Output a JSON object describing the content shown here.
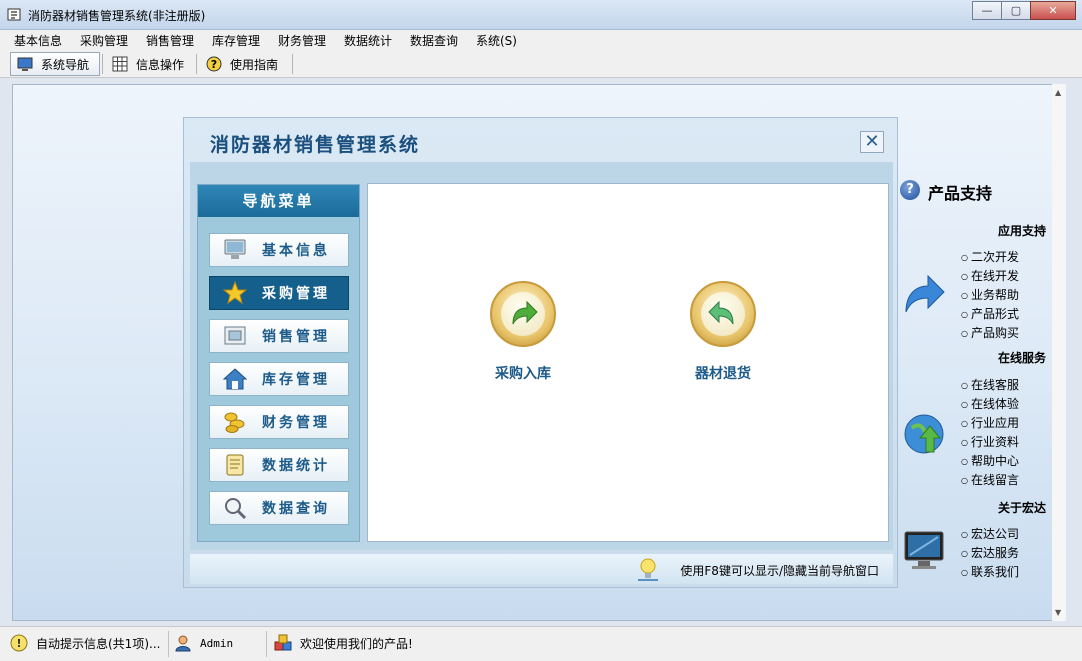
{
  "window": {
    "title": "消防器材销售管理系统(非注册版)"
  },
  "menubar": [
    "基本信息",
    "采购管理",
    "销售管理",
    "库存管理",
    "财务管理",
    "数据统计",
    "数据查询",
    "系统(S)"
  ],
  "toolbar": {
    "nav": "系统导航",
    "info": "信息操作",
    "guide": "使用指南"
  },
  "navwin": {
    "title": "消防器材销售管理系统",
    "menu_header": "导航菜单",
    "menu_items": [
      "基本信息",
      "采购管理",
      "销售管理",
      "库存管理",
      "财务管理",
      "数据统计",
      "数据查询"
    ],
    "selected": "采购管理",
    "functions": [
      "采购入库",
      "器材退货"
    ],
    "hint": "使用F8键可以显示/隐藏当前导航窗口"
  },
  "support": {
    "title": "产品支持",
    "sections": [
      {
        "title": "应用支持",
        "links": [
          "二次开发",
          "在线开发",
          "业务帮助",
          "产品形式",
          "产品购买"
        ]
      },
      {
        "title": "在线服务",
        "links": [
          "在线客服",
          "在线体验",
          "行业应用",
          "行业资料",
          "帮助中心",
          "在线留言"
        ]
      },
      {
        "title": "关于宏达",
        "links": [
          "宏达公司",
          "宏达服务",
          "联系我们"
        ]
      }
    ]
  },
  "statusbar": {
    "tips": "自动提示信息(共1项)...",
    "user": "Admin",
    "welcome": "欢迎使用我们的产品!"
  },
  "colors": {
    "accent": "#1d5b8a",
    "header": "#1a6a9a",
    "selected": "#155f8d"
  }
}
